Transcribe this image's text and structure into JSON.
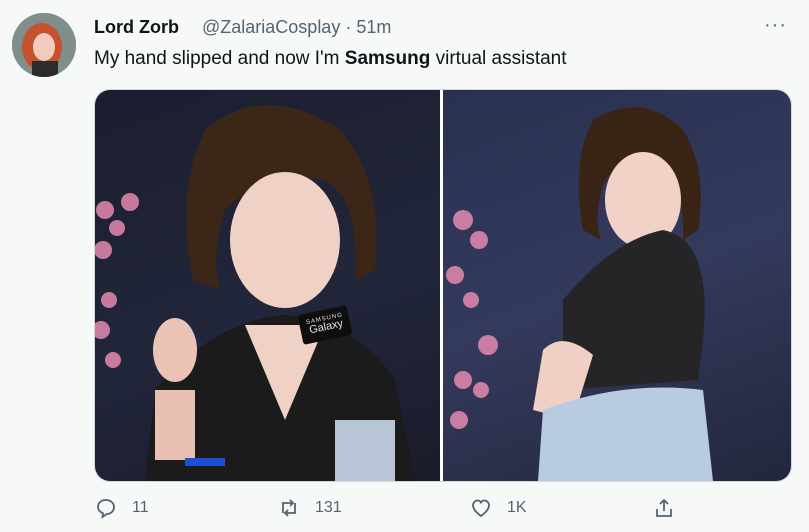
{
  "tweet": {
    "display_name": "Lord Zorb",
    "handle_time": "@ZalariaCosplay · 51m",
    "text_before": "My hand slipped and now I'm ",
    "text_bold": "Samsung",
    "text_after": " virtual assistant",
    "more_label": "···"
  },
  "media": {
    "left_photo_logo_line1": "SAMSUNG",
    "left_photo_logo_line2": "Galaxy"
  },
  "actions": {
    "replies": "11",
    "retweets": "131",
    "likes": "1K"
  },
  "colors": {
    "background": "#f7f9f9",
    "text": "#0f1419",
    "muted": "#536471",
    "border": "#cfd9de"
  }
}
